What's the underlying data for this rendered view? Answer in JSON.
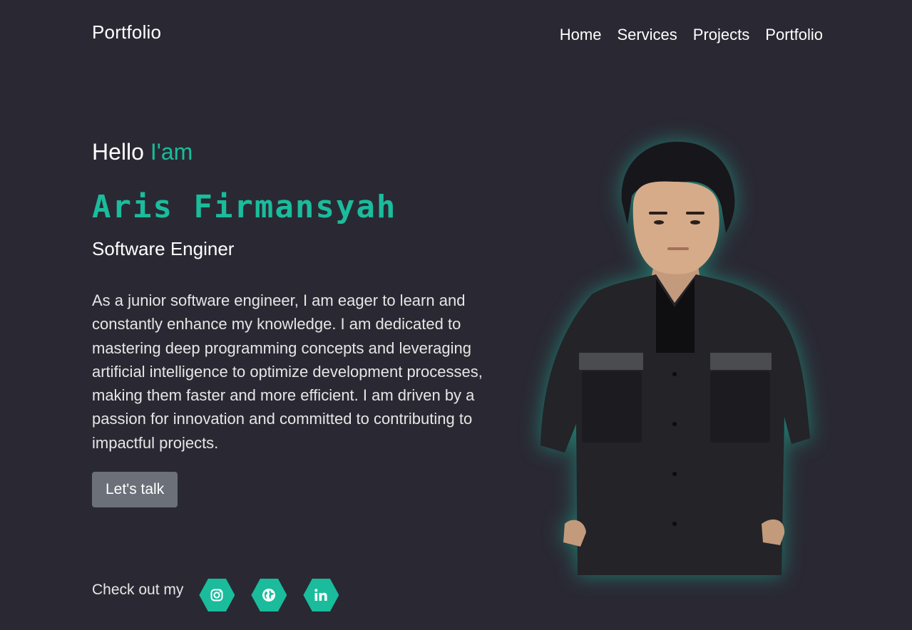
{
  "header": {
    "brand": "Portfolio",
    "nav": [
      "Home",
      "Services",
      "Projects",
      "Portfolio"
    ]
  },
  "hero": {
    "greeting": "Hello",
    "greeting_accent": "I'am",
    "name": "Aris Firmansyah",
    "role": "Software Enginer",
    "bio": "As a junior software engineer, I am eager to learn and constantly enhance my knowledge. I am dedicated to mastering deep programming concepts and leveraging artificial intelligence to optimize development processes, making them faster and more efficient. I am driven by a passion for innovation and committed to contributing to impactful projects.",
    "cta_label": "Let's talk"
  },
  "social": {
    "label": "Check out my",
    "links": [
      {
        "icon": "instagram-icon"
      },
      {
        "icon": "globe-icon"
      },
      {
        "icon": "linkedin-icon"
      }
    ]
  },
  "colors": {
    "background": "#2a2933",
    "accent": "#1abc9c",
    "button": "#6b7079"
  }
}
